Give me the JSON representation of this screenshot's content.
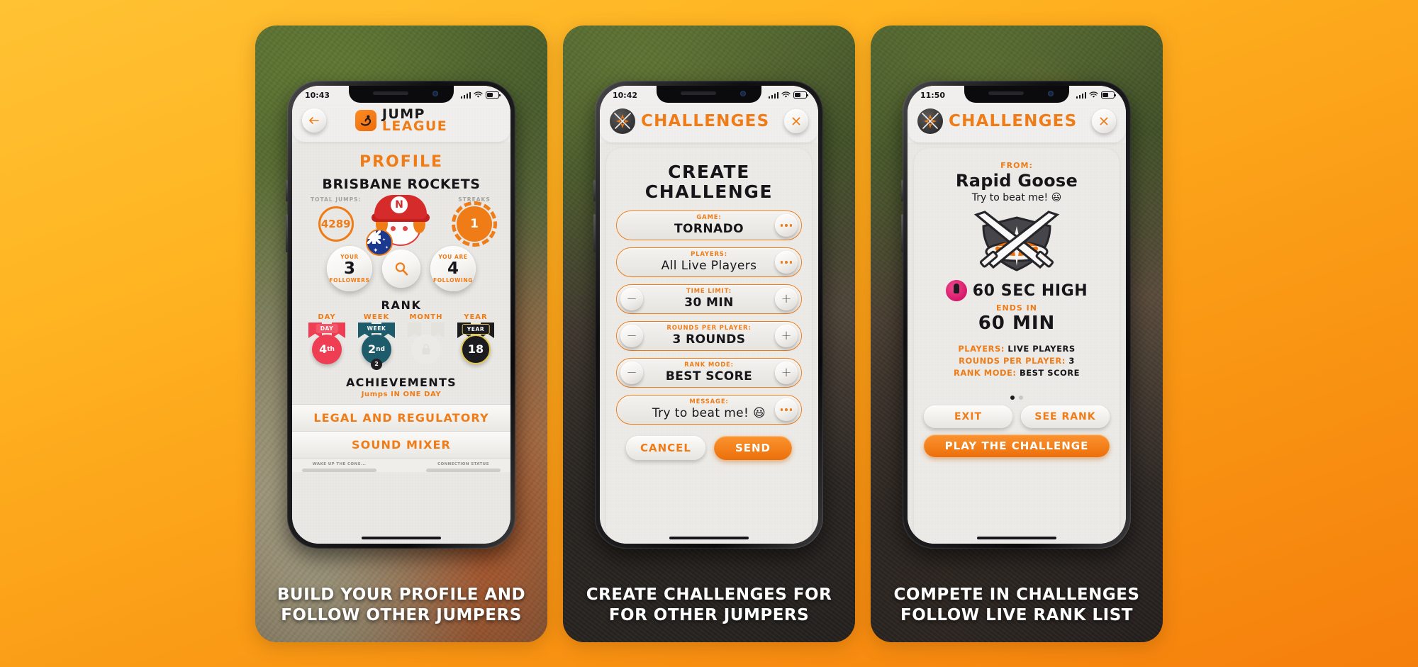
{
  "brand": {
    "accent": "#f07c18",
    "dark": "#16161a"
  },
  "cards": [
    {
      "caption_line1": "BUILD YOUR PROFILE AND",
      "caption_line2": "FOLLOW OTHER JUMPERS",
      "status": {
        "time": "10:43"
      },
      "header": {
        "back_icon": "back-arrow-icon",
        "logo_icon": "jump-league-logo-icon",
        "logo_line1": "JUMP",
        "logo_line2": "LEAGUE"
      },
      "profile": {
        "title": "PROFILE",
        "team_name": "BRISBANE ROCKETS",
        "total_jumps_label": "TOTAL JUMPS:",
        "total_jumps_value": "4289",
        "streaks_label": "STREAKS",
        "streaks_value": "1",
        "avatar_badge": "N",
        "followers": {
          "top": "YOUR",
          "num": "3",
          "bot": "FOLLOWERS"
        },
        "following": {
          "top": "YOU ARE",
          "num": "4",
          "bot": "FOLLOWING"
        },
        "search_icon": "search-icon",
        "rank_title": "RANK",
        "medals": [
          {
            "caption": "DAY",
            "tag": "DAY",
            "value": "4",
            "suffix": "th",
            "color": "#ef3d53",
            "ribbon": "#ef3d53",
            "tagbg": "#f2566a",
            "locked": false,
            "sub": ""
          },
          {
            "caption": "WEEK",
            "tag": "WEEK",
            "value": "2",
            "suffix": "nd",
            "color": "#1f5c6b",
            "ribbon": "#1f5c6b",
            "tagbg": "#1f5c6b",
            "locked": false,
            "sub": "2"
          },
          {
            "caption": "MONTH",
            "tag": "",
            "value": "",
            "suffix": "",
            "color": "#e4e2dd",
            "ribbon": "#e4e2dd",
            "tagbg": "#e4e2dd",
            "locked": true,
            "sub": ""
          },
          {
            "caption": "YEAR",
            "tag": "YEAR",
            "value": "18",
            "suffix": "",
            "color": "#1c1c20",
            "ribbon": "#1c1c20",
            "tagbg": "#1c1c20",
            "locked": false,
            "sub": ""
          }
        ],
        "achievements_title": "ACHIEVEMENTS",
        "achievements_sub": "Jumps IN ONE DAY",
        "menu": [
          "LEGAL AND REGULATORY",
          "SOUND MIXER"
        ],
        "footer_left": "WAKE UP THE CONS...",
        "footer_right": "CONNECTION STATUS"
      }
    },
    {
      "caption_line1": "CREATE CHALLENGES FOR",
      "caption_line2": "FOR OTHER JUMPERS",
      "status": {
        "time": "10:42"
      },
      "header": {
        "logo_icon": "crossed-swords-logo-icon",
        "title": "CHALLENGES",
        "close_icon": "close-icon"
      },
      "create": {
        "title_line1": "CREATE",
        "title_line2": "CHALLENGE",
        "fields": [
          {
            "label": "GAME:",
            "value": "TORNADO",
            "control": "dots",
            "bold": true
          },
          {
            "label": "PLAYERS:",
            "value": "All Live Players",
            "control": "dots",
            "bold": false
          },
          {
            "label": "TIME LIMIT:",
            "value": "30 MIN",
            "control": "stepper",
            "bold": true
          },
          {
            "label": "ROUNDS PER PLAYER:",
            "value": "3 ROUNDS",
            "control": "stepper",
            "bold": true
          },
          {
            "label": "RANK MODE:",
            "value": "BEST SCORE",
            "control": "stepper",
            "bold": true
          },
          {
            "label": "MESSAGE:",
            "value": "Try to beat me! 😃",
            "control": "dots",
            "bold": false
          }
        ],
        "cancel_label": "CANCEL",
        "send_label": "SEND"
      }
    },
    {
      "caption_line1": "COMPETE IN CHALLENGES",
      "caption_line2": "FOLLOW LIVE RANK LIST",
      "status": {
        "time": "11:50"
      },
      "header": {
        "logo_icon": "crossed-swords-logo-icon",
        "title": "CHALLENGES",
        "close_icon": "close-icon"
      },
      "invite": {
        "from_label": "FROM:",
        "from_name": "Rapid Goose",
        "message": "Try to beat me! 😃",
        "crest_icon": "crossed-swords-crest-icon",
        "game_icon": "tornado-game-icon",
        "game_name": "60 SEC HIGH",
        "ends_label": "ENDS IN",
        "ends_value": "60 MIN",
        "meta": [
          {
            "key": "PLAYERS:",
            "val": "LIVE PLAYERS"
          },
          {
            "key": "ROUNDS PER PLAYER:",
            "val": "3"
          },
          {
            "key": "RANK MODE:",
            "val": "BEST SCORE"
          }
        ],
        "page_dots": 2,
        "page_active": 0,
        "exit_label": "EXIT",
        "see_rank_label": "SEE RANK",
        "play_label": "PLAY THE CHALLENGE"
      }
    }
  ]
}
